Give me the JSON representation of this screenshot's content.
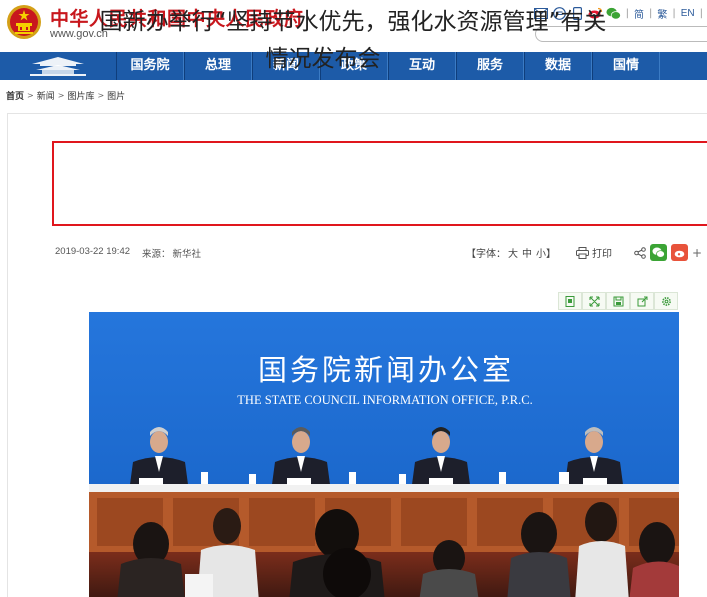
{
  "header": {
    "site_title": "中华人民共和国中央人民政府",
    "site_url": "www.gov.cn",
    "tools": {
      "icons": [
        "mail-icon",
        "message-icon",
        "mobile-icon",
        "weibo-icon",
        "wechat-icon"
      ],
      "lang_simplified": "简",
      "lang_traditional": "繁",
      "lang_english": "EN"
    },
    "search": {
      "placeholder": ""
    }
  },
  "nav": {
    "items": [
      "国务院",
      "总理",
      "新闻",
      "政策",
      "互动",
      "服务",
      "数据",
      "国情"
    ]
  },
  "breadcrumb": [
    "首页",
    "新闻",
    "图片库",
    "图片"
  ],
  "article": {
    "title_line1": "国新办举行“坚持节水优先，强化水资源管理”有关",
    "title_line2": "情况发布会",
    "date": "2019-03-22 19:42",
    "source_label": "来源：",
    "source": "新华社",
    "font_size_label": "【字体：",
    "font_large": "大",
    "font_medium": "中",
    "font_small": "小】",
    "print_label": "打印"
  },
  "image_tools": [
    "image-icon",
    "fullscreen-icon",
    "save-icon",
    "share-icon",
    "settings-icon"
  ],
  "photo": {
    "backdrop_title_cn": "国务院新闻办公室",
    "backdrop_title_en": "THE STATE COUNCIL INFORMATION OFFICE, P.R.C."
  },
  "colors": {
    "brand_red": "#c8171d",
    "nav_blue": "#1d5ba8",
    "title_border": "#e0161d",
    "backdrop_blue": "#1c6ad0"
  }
}
